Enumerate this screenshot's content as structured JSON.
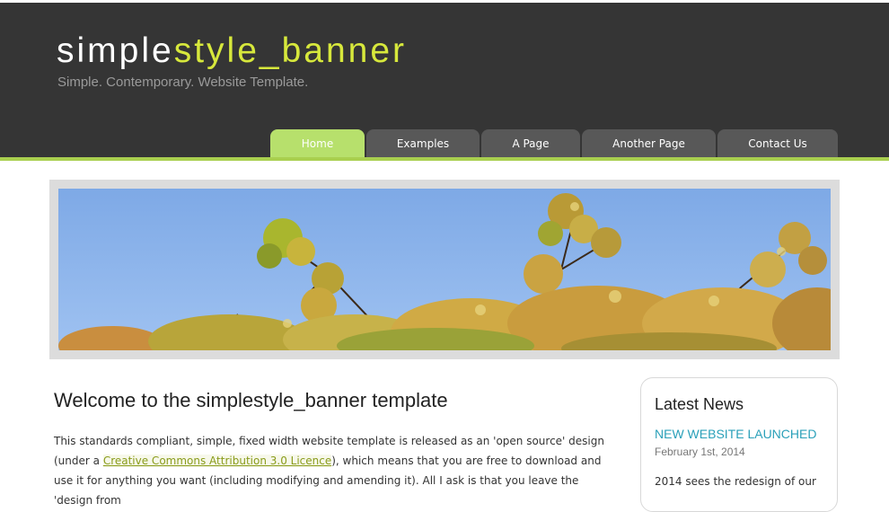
{
  "header": {
    "logo_part1": "simple",
    "logo_part2": "style_banner",
    "slogan": "Simple. Contemporary. Website Template."
  },
  "menu": {
    "items": [
      {
        "label": "Home",
        "active": true
      },
      {
        "label": "Examples"
      },
      {
        "label": "A Page"
      },
      {
        "label": "Another Page"
      },
      {
        "label": "Contact Us"
      }
    ]
  },
  "content": {
    "title": "Welcome to the simplestyle_banner template",
    "para_before_link": "This standards compliant, simple, fixed width website template is released as an 'open source' design (under a ",
    "link_text": "Creative Commons Attribution 3.0 Licence",
    "para_after_link": "), which means that you are free to download and use it for anything you want (including modifying and amending it). All I ask is that you leave the 'design from"
  },
  "sidebar": {
    "title": "Latest News",
    "news_headline": "NEW WEBSITE LAUNCHED",
    "news_date": "February 1st, 2014",
    "news_text": "2014 sees the redesign of our"
  },
  "colors": {
    "header_bg": "#353535",
    "accent_green": "#a9cf4f",
    "logo_yellow": "#d7e83c",
    "menu_tab": "#585858",
    "menu_active": "#b7e06c",
    "news_link": "#2aa0b9"
  }
}
